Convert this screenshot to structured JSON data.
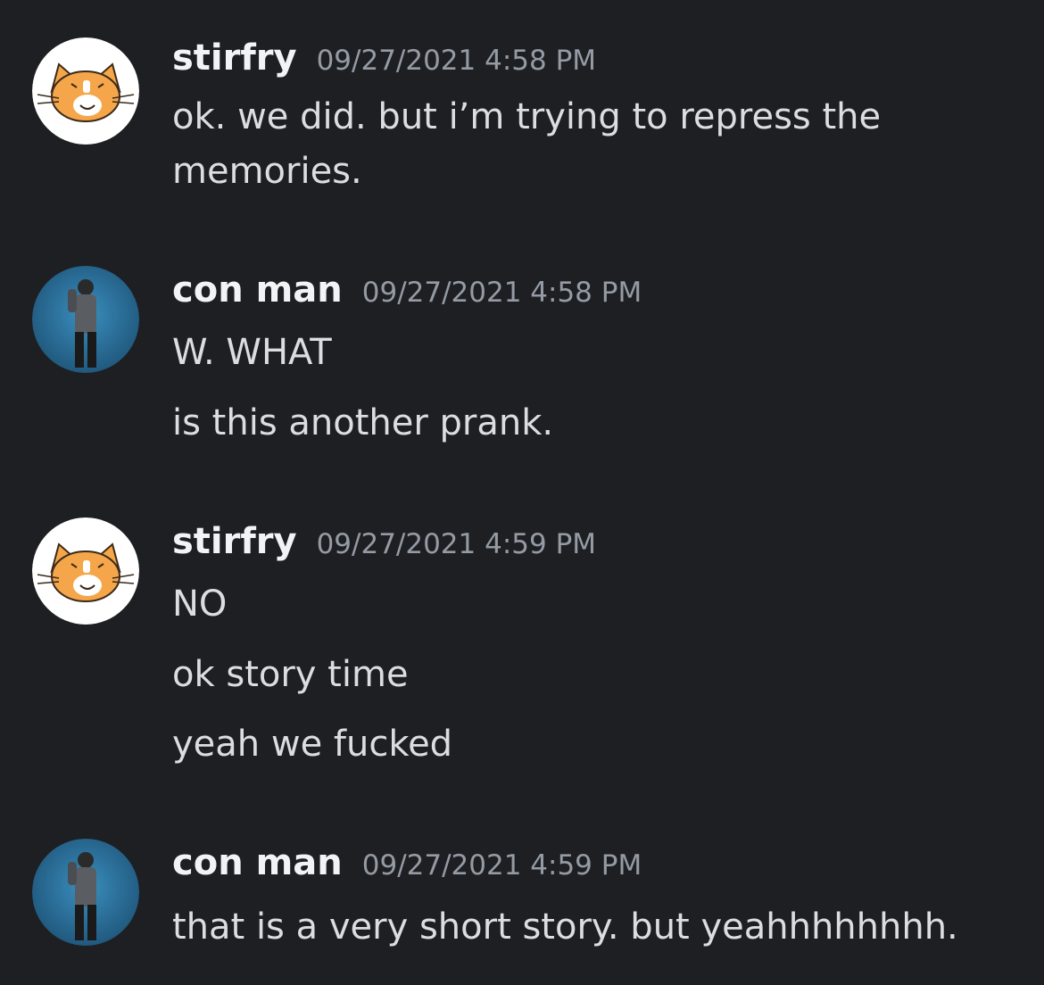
{
  "colors": {
    "background": "#1e1f22",
    "username": "#f2f3f5",
    "timestamp": "#949ba4",
    "message_text": "#dbdee1"
  },
  "messages": [
    {
      "username": "stirfry",
      "avatar_icon": "orange-cat-icon",
      "timestamp": "09/27/2021 4:58 PM",
      "lines": [
        "ok. we did. but i’m trying to repress the",
        "memories."
      ]
    },
    {
      "username": "con man",
      "avatar_icon": "person-photo-icon",
      "timestamp": "09/27/2021 4:58 PM",
      "lines": [
        "W. WHAT",
        "is this another prank."
      ]
    },
    {
      "username": "stirfry",
      "avatar_icon": "orange-cat-icon",
      "timestamp": "09/27/2021 4:59 PM",
      "lines": [
        "NO",
        "ok story time",
        "yeah we fucked"
      ]
    },
    {
      "username": "con man",
      "avatar_icon": "person-photo-icon",
      "timestamp": "09/27/2021 4:59 PM",
      "lines": [
        "that is a very short story. but yeahhhhhhhh."
      ]
    }
  ]
}
